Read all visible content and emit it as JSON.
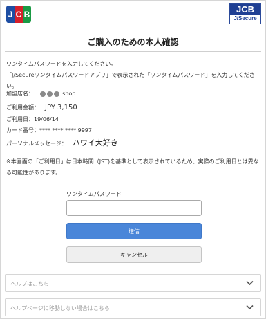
{
  "header": {
    "left_logo": [
      "J",
      "C",
      "B"
    ],
    "right_logo_top": "JCB",
    "right_logo_bottom": "J/Secure",
    "brand_colors": {
      "blue": "#1e4ea3",
      "red": "#d6202b",
      "green": "#1a9a44"
    }
  },
  "title": "ご購入のための本人確認",
  "intro": {
    "line1": "ワンタイムパスワードを入力してください。",
    "line2": "「J/Secureワンタイムパスワードアプリ」で表示された「ワンタイムパスワード」を入力してください。"
  },
  "details": {
    "merchant_label": "加盟店名：",
    "merchant_value": "shop",
    "amount_label": "ご利用金額：",
    "amount_value": "JPY 3,150",
    "date_label": "ご利用日：19/06/14",
    "card_label": "カード番号：**** **** **** 9997",
    "message_label": "パーソナルメッセージ：",
    "message_value": "ハワイ大好き"
  },
  "notice": "※本画面の「ご利用日」は日本時間（JST)を基準として表示されているため、実際のご利用日とは異なる可能性があります。",
  "form": {
    "otp_label": "ワンタイムパスワード",
    "otp_value": "",
    "send_label": "送信",
    "cancel_label": "キャンセル"
  },
  "accordions": [
    {
      "label": "ヘルプはこちら"
    },
    {
      "label": "ヘルプページに移動しない場合はこちら"
    }
  ]
}
